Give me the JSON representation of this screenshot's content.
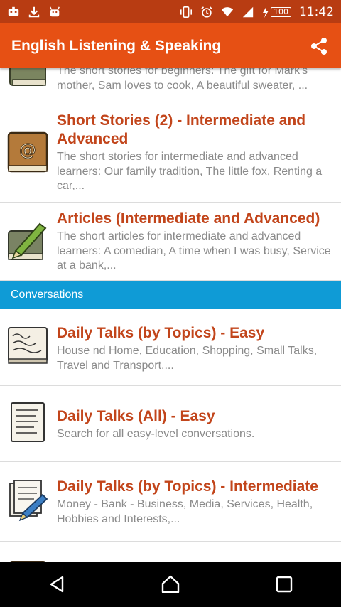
{
  "status_bar": {
    "battery": "100",
    "time": "11:42",
    "icons": [
      "notification-icon",
      "download-icon",
      "android-icon",
      "vibrate-icon",
      "alarm-icon",
      "wifi-icon",
      "signal-icon",
      "charging-icon"
    ]
  },
  "app_bar": {
    "title": "English Listening & Speaking",
    "share_icon": "share-icon"
  },
  "items_top": [
    {
      "title": "",
      "desc": "The short stories for beginners: The gift for Mark's mother, Sam loves to cook, A beautiful sweater, ...",
      "icon": "book-icon"
    },
    {
      "title": "Short Stories (2) - Intermediate and Advanced",
      "desc": "The short stories for intermediate and advanced learners: Our family tradition, The little fox, Renting a car,...",
      "icon": "address-book-icon"
    },
    {
      "title": "Articles (Intermediate and Advanced)",
      "desc": "The short articles for intermediate and advanced learners: A comedian, A time when I was busy, Service at a bank,...",
      "icon": "book-pen-icon"
    }
  ],
  "section": {
    "label": "Conversations"
  },
  "items_conv": [
    {
      "title": "Daily Talks (by Topics) - Easy",
      "desc": "House nd Home, Education, Shopping, Small Talks, Travel and Transport,...",
      "icon": "handwritten-note-icon"
    },
    {
      "title": "Daily Talks (All) - Easy",
      "desc": "Search for all easy-level conversations.",
      "icon": "notepad-icon"
    },
    {
      "title": "Daily Talks (by Topics) - Intermediate",
      "desc": "Money - Bank - Business, Media, Services, Health, Hobbies and Interests,...",
      "icon": "documents-pen-icon"
    }
  ],
  "nav_bar": {
    "icons": [
      "back-icon",
      "home-icon",
      "recents-icon"
    ]
  },
  "colors": {
    "status_bar": "#b83c12",
    "app_bar": "#e65014",
    "title_text": "#c2451b",
    "section": "#0f9bd6",
    "desc_text": "#8a8a8a"
  }
}
